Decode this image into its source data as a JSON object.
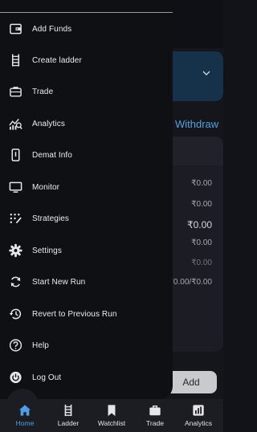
{
  "background": {
    "withdraw_label": "Withdraw",
    "values": [
      "₹0.00",
      "₹0.00",
      "₹0.00",
      "₹0.00",
      "₹0.00",
      "₹0.00/₹0.00"
    ],
    "add_label": "Add"
  },
  "drawer": {
    "items": [
      {
        "label": "Add Funds",
        "icon": "wallet-icon"
      },
      {
        "label": "Create ladder",
        "icon": "ladder-icon"
      },
      {
        "label": "Trade",
        "icon": "briefcase-icon"
      },
      {
        "label": "Analytics",
        "icon": "analytics-icon"
      },
      {
        "label": "Demat Info",
        "icon": "phone-icon"
      },
      {
        "label": "Monitor",
        "icon": "monitor-icon"
      },
      {
        "label": "Strategies",
        "icon": "strategies-icon"
      },
      {
        "label": "Settings",
        "icon": "gear-icon"
      },
      {
        "label": "Start New Run",
        "icon": "refresh-icon"
      },
      {
        "label": "Revert to Previous Run",
        "icon": "history-icon"
      },
      {
        "label": "Help",
        "icon": "help-icon"
      },
      {
        "label": "Log Out",
        "icon": "power-icon"
      }
    ]
  },
  "bottom_nav": {
    "items": [
      {
        "label": "Home",
        "icon": "home-icon",
        "active": true
      },
      {
        "label": "Ladder",
        "icon": "ladder-icon"
      },
      {
        "label": "Watchlist",
        "icon": "bookmark-icon"
      },
      {
        "label": "Trade",
        "icon": "briefcase-icon"
      },
      {
        "label": "Analytics",
        "icon": "analytics-icon"
      }
    ]
  },
  "colors": {
    "accent": "#4ea0e6",
    "drawer_bg": "#0f1014",
    "nav_bg": "#1c1d23"
  }
}
